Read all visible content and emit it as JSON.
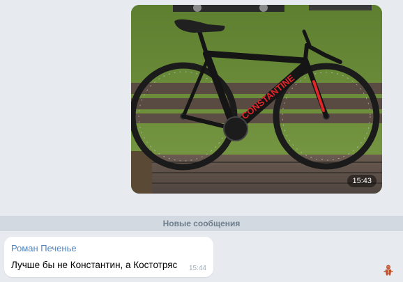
{
  "photo_message": {
    "image_label": "CONSTANTINE",
    "time": "15:43"
  },
  "divider": {
    "label": "Новые сообщения"
  },
  "text_message": {
    "sender": "Роман Печенье",
    "text": "Лучше бы не Константин, а Костотряс",
    "time": "15:44"
  },
  "colors": {
    "sender_name": "#4f86c6",
    "chat_background": "#e7ebf0",
    "bike_accent": "#e3262a"
  },
  "icons": {
    "reaction": "gingerbread-man-icon"
  }
}
